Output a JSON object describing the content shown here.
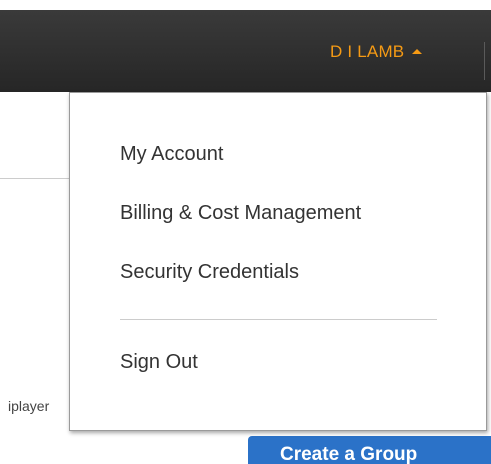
{
  "header": {
    "user_name": "D I LAMB"
  },
  "dropdown": {
    "items": [
      {
        "label": "My Account"
      },
      {
        "label": "Billing & Cost Management"
      },
      {
        "label": "Security Credentials"
      }
    ],
    "sign_out": "Sign Out"
  },
  "background": {
    "iplayer_text": "iplayer",
    "create_group_button": "Create a Group"
  },
  "colors": {
    "accent": "#f59a14",
    "header_bg": "#2e2e2e",
    "button_blue": "#2b72c8"
  },
  "icons": {
    "user_menu_caret": "caret-up-icon"
  }
}
